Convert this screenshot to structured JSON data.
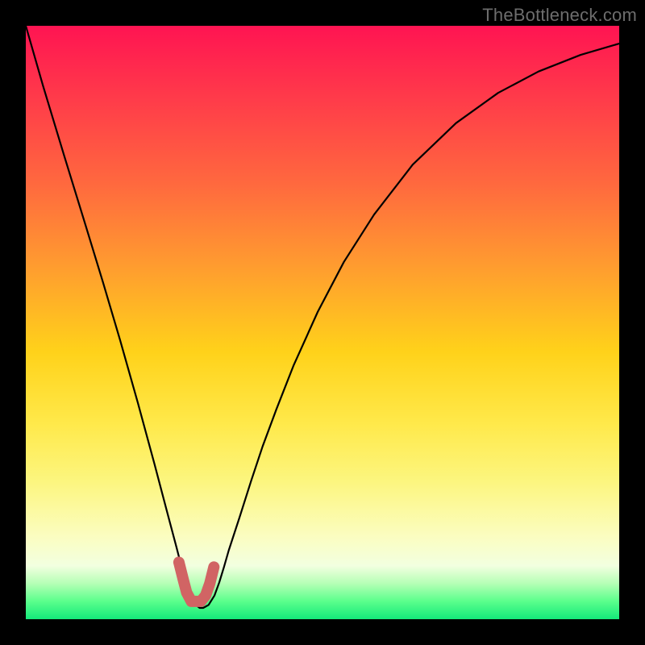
{
  "watermark": "TheBottleneck.com",
  "chart_data": {
    "type": "line",
    "title": "",
    "xlabel": "",
    "ylabel": "",
    "xlim": [
      0,
      100
    ],
    "ylim": [
      0,
      100
    ],
    "grid": false,
    "series": [
      {
        "name": "curve",
        "color": "#000000",
        "x": [
          0,
          2.9,
          6.5,
          10.1,
          13.0,
          15.9,
          18.9,
          21.7,
          23.7,
          25.4,
          26.4,
          27.1,
          27.9,
          29.3,
          29.9,
          30.8,
          31.8,
          32.6,
          33.4,
          34.2,
          36.0,
          38.0,
          39.9,
          42.2,
          45.1,
          49.2,
          53.6,
          58.7,
          65.2,
          72.5,
          79.6,
          86.4,
          93.5,
          100.0
        ],
        "y": [
          100.0,
          89.9,
          78.0,
          66.3,
          56.8,
          47.0,
          36.4,
          26.1,
          18.5,
          12.1,
          8.2,
          5.3,
          3.0,
          1.9,
          1.9,
          2.4,
          4.0,
          6.2,
          8.8,
          11.6,
          17.1,
          23.4,
          29.1,
          35.3,
          42.7,
          51.8,
          60.2,
          68.2,
          76.6,
          83.6,
          88.7,
          92.3,
          95.1,
          97.0
        ]
      },
      {
        "name": "minimum-marker",
        "color": "#d16464",
        "x": [
          25.8,
          26.5,
          27.1,
          27.9,
          28.8,
          29.5,
          30.3,
          31.0,
          31.7
        ],
        "y": [
          9.6,
          6.8,
          4.5,
          3.0,
          3.0,
          3.0,
          4.0,
          6.0,
          8.8
        ]
      }
    ],
    "gradient_stops": [
      {
        "pos": 0.0,
        "color": "#ff1452"
      },
      {
        "pos": 0.12,
        "color": "#ff3a4a"
      },
      {
        "pos": 0.27,
        "color": "#ff6a3e"
      },
      {
        "pos": 0.4,
        "color": "#ff9a30"
      },
      {
        "pos": 0.55,
        "color": "#ffd21a"
      },
      {
        "pos": 0.67,
        "color": "#ffe94a"
      },
      {
        "pos": 0.77,
        "color": "#fcf680"
      },
      {
        "pos": 0.86,
        "color": "#fbfdc0"
      },
      {
        "pos": 0.91,
        "color": "#f2ffe0"
      },
      {
        "pos": 0.94,
        "color": "#b5ffb5"
      },
      {
        "pos": 0.97,
        "color": "#5aff8c"
      },
      {
        "pos": 1.0,
        "color": "#14e87a"
      }
    ]
  }
}
